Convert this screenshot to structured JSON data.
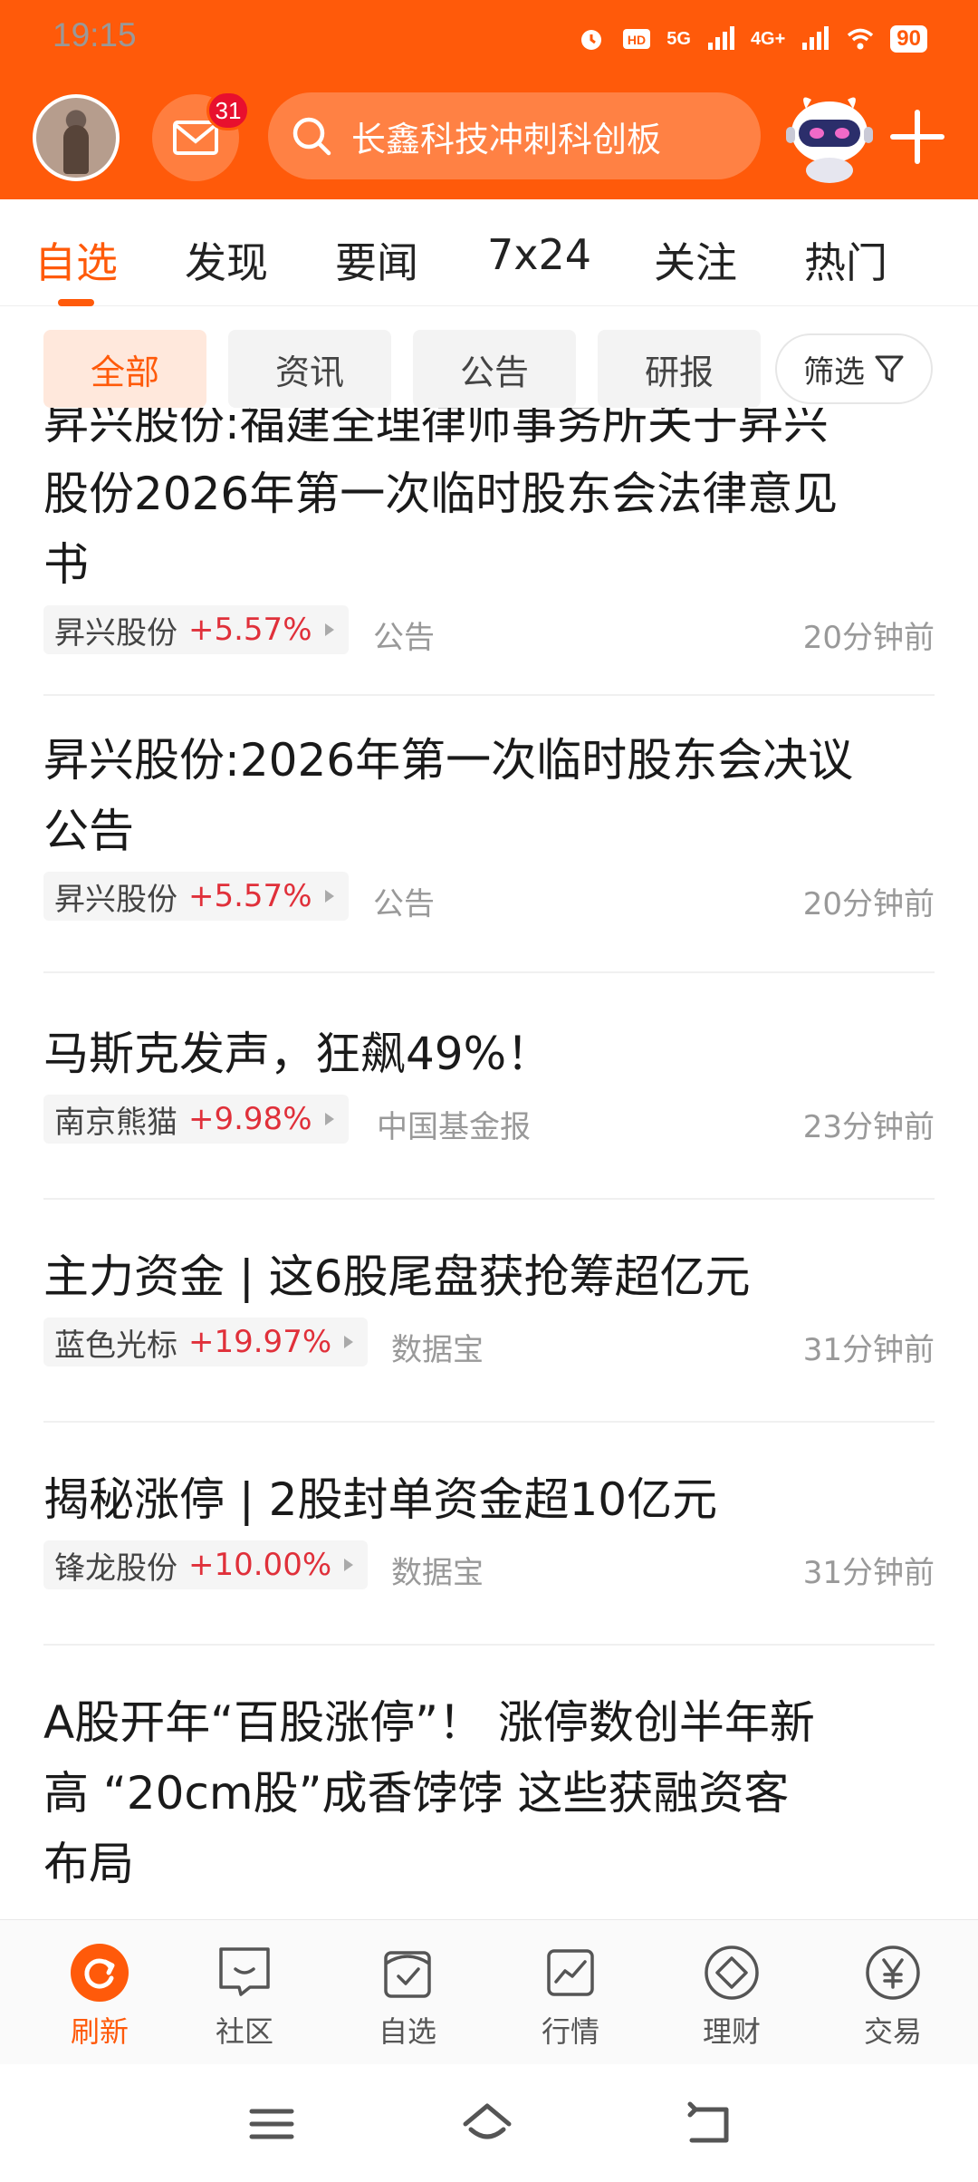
{
  "status_bar": {
    "time": "19:15",
    "battery": "90",
    "signal_5g": "5G",
    "signal_4g": "4G+"
  },
  "header": {
    "mail_badge": "31",
    "search_query": "长鑫科技冲刺科创板"
  },
  "tabs": [
    "自选",
    "发现",
    "要闻",
    "7x24",
    "关注",
    "热门"
  ],
  "filters": {
    "chips": [
      "全部",
      "资讯",
      "公告",
      "研报"
    ],
    "filter_label": "筛选"
  },
  "feed": [
    {
      "title_lines": [
        "昇兴股份:福建全理律师事务所关于昇兴",
        "股份2026年第一次临时股东会法律意见",
        "书"
      ],
      "stock": "昇兴股份",
      "change": "+5.57%",
      "source": "公告",
      "time": "20分钟前"
    },
    {
      "title_lines": [
        "昇兴股份:2026年第一次临时股东会决议",
        "公告"
      ],
      "stock": "昇兴股份",
      "change": "+5.57%",
      "source": "公告",
      "time": "20分钟前"
    },
    {
      "title_lines": [
        "马斯克发声，狂飙49%！"
      ],
      "stock": "南京熊猫",
      "change": "+9.98%",
      "source": "中国基金报",
      "time": "23分钟前"
    },
    {
      "title_lines": [
        "主力资金 | 这6股尾盘获抢筹超亿元"
      ],
      "stock": "蓝色光标",
      "change": "+19.97%",
      "source": "数据宝",
      "time": "31分钟前"
    },
    {
      "title_lines": [
        "揭秘涨停 | 2股封单资金超10亿元"
      ],
      "stock": "锋龙股份",
      "change": "+10.00%",
      "source": "数据宝",
      "time": "31分钟前"
    },
    {
      "title_lines": [
        "A股开年“百股涨停”！ 涨停数创半年新",
        "高 “20cm股”成香饽饽 这些获融资客",
        "布局"
      ]
    }
  ],
  "bottom_nav": [
    "刷新",
    "社区",
    "自选",
    "行情",
    "理财",
    "交易"
  ],
  "colors": {
    "accent": "#ff5a0a",
    "up": "#e0303a"
  }
}
